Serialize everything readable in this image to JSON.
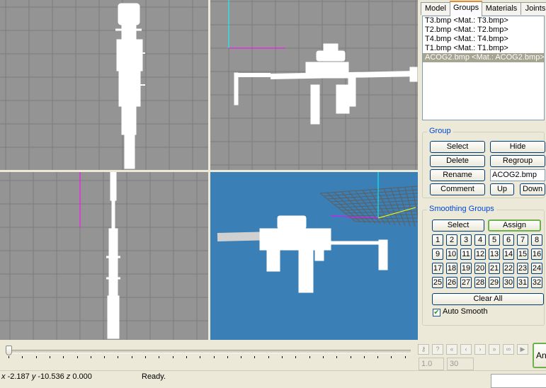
{
  "tabs": [
    "Model",
    "Groups",
    "Materials",
    "Joints"
  ],
  "active_tab": "Groups",
  "groups_list": [
    "T3.bmp <Mat.: T3.bmp>",
    "T2.bmp <Mat.: T2.bmp>",
    "T4.bmp <Mat.: T4.bmp>",
    "T1.bmp <Mat.: T1.bmp>",
    "ACOG2.bmp <Mat.: ACOG2.bmp>"
  ],
  "selected_group": "ACOG2.bmp <Mat.: ACOG2.bmp>",
  "group_section": {
    "title": "Group",
    "select": "Select",
    "hide": "Hide",
    "delete": "Delete",
    "regroup": "Regroup",
    "rename": "Rename",
    "name_value": "ACOG2.bmp",
    "comment": "Comment",
    "up": "Up",
    "down": "Down"
  },
  "smoothing": {
    "title": "Smoothing Groups",
    "select": "Select",
    "assign": "Assign",
    "numbers": [
      "1",
      "2",
      "3",
      "4",
      "5",
      "6",
      "7",
      "8",
      "9",
      "10",
      "11",
      "12",
      "13",
      "14",
      "15",
      "16",
      "17",
      "18",
      "19",
      "20",
      "21",
      "22",
      "23",
      "24",
      "25",
      "26",
      "27",
      "28",
      "29",
      "30",
      "31",
      "32"
    ],
    "clear_all": "Clear All",
    "auto_smooth": "Auto Smooth",
    "auto_smooth_checked": true
  },
  "timeline": {
    "start_frame": "1.0",
    "end_frame": "30",
    "buttons": [
      "key-icon",
      "help-icon",
      "first-frame-icon",
      "prev-frame-icon",
      "next-frame-icon",
      "last-frame-icon",
      "loop-icon",
      "play-icon"
    ],
    "anim_button": "An"
  },
  "status": {
    "x_label": "x",
    "x": "-2.187",
    "y_label": "y",
    "y": "-10.536",
    "z_label": "z",
    "z": "0.000",
    "message": "Ready."
  },
  "colors": {
    "viewport_bg": "#949494",
    "viewport_3d_bg": "#3a7fb5",
    "grid": "#7d7d7d",
    "mesh": "#ffffff",
    "axis_x": "#ff00ff",
    "axis_y": "#00ffff",
    "axis_z": "#ffff00",
    "selection": "#a5a591"
  }
}
